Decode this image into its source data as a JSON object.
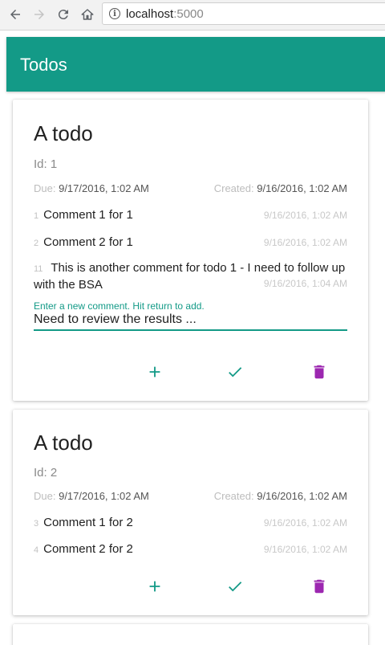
{
  "browser": {
    "url_host": "localhost",
    "url_port": ":5000"
  },
  "app": {
    "title": "Todos"
  },
  "labels": {
    "due": "Due:",
    "created": "Created:",
    "comment_field_label": "Enter a new comment. Hit return to add."
  },
  "todos": [
    {
      "title": "A todo",
      "id_text": "Id: 1",
      "due": "9/17/2016, 1:02 AM",
      "created": "9/16/2016, 1:02 AM",
      "comments": [
        {
          "id": "1",
          "text": "Comment 1 for 1",
          "timestamp": "9/16/2016, 1:02 AM"
        },
        {
          "id": "2",
          "text": "Comment 2 for 1",
          "timestamp": "9/16/2016, 1:02 AM"
        },
        {
          "id": "11",
          "text": "This is another comment for todo 1 - I need to follow up with the BSA",
          "timestamp": "9/16/2016, 1:04 AM"
        }
      ],
      "new_comment_value": "Need to review the results ..."
    },
    {
      "title": "A todo",
      "id_text": "Id: 2",
      "due": "9/17/2016, 1:02 AM",
      "created": "9/16/2016, 1:02 AM",
      "comments": [
        {
          "id": "3",
          "text": "Comment 1 for 2",
          "timestamp": "9/16/2016, 1:02 AM"
        },
        {
          "id": "4",
          "text": "Comment 2 for 2",
          "timestamp": "9/16/2016, 1:02 AM"
        }
      ]
    }
  ],
  "icons": {
    "add": "plus-icon",
    "complete": "check-icon",
    "delete": "trash-icon"
  },
  "colors": {
    "primary": "#139a87",
    "delete": "#9c27b0"
  }
}
